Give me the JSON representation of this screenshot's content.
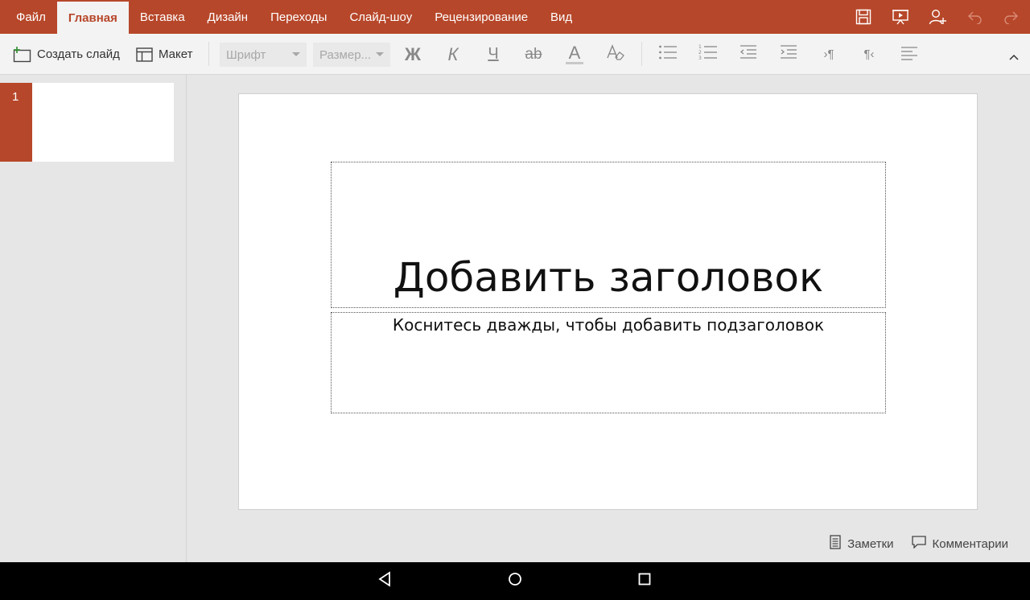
{
  "menu": {
    "tabs": [
      {
        "label": "Файл"
      },
      {
        "label": "Главная"
      },
      {
        "label": "Вставка"
      },
      {
        "label": "Дизайн"
      },
      {
        "label": "Переходы"
      },
      {
        "label": "Слайд-шоу"
      },
      {
        "label": "Рецензирование"
      },
      {
        "label": "Вид"
      }
    ],
    "active_tab": "Главная",
    "right_icons": [
      "save-icon",
      "present-icon",
      "share-user-icon",
      "undo-icon",
      "redo-icon"
    ]
  },
  "ribbon": {
    "new_slide_label": "Создать слайд",
    "layout_label": "Макет",
    "font_placeholder": "Шрифт",
    "size_placeholder": "Размер...",
    "bold_glyph": "Ж",
    "italic_glyph": "К",
    "underline_glyph": "Ч",
    "strike_glyph": "ab",
    "font_color_glyph": "A",
    "collapse_icon": "chevron-up-icon"
  },
  "slides_panel": {
    "slides": [
      {
        "number": "1"
      }
    ]
  },
  "slide": {
    "title_placeholder": "Добавить заголовок",
    "subtitle_placeholder": "Коснитесь дважды, чтобы добавить подзаголовок"
  },
  "status": {
    "notes_label": "Заметки",
    "comments_label": "Комментарии"
  },
  "colors": {
    "accent": "#b7472a",
    "ribbon_bg": "#f3f3f3",
    "workspace_bg": "#e6e6e6"
  }
}
